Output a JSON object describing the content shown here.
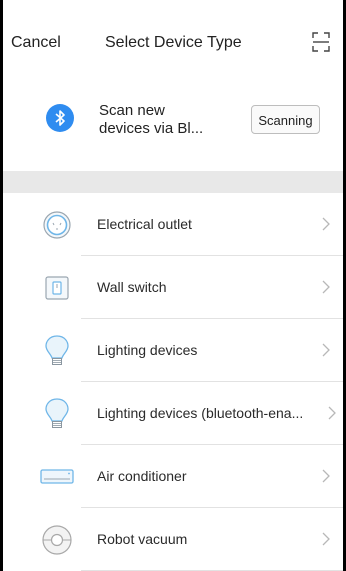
{
  "header": {
    "cancel_label": "Cancel",
    "title": "Select Device Type",
    "scan_icon": "scan-frame-icon"
  },
  "scan": {
    "icon": "bluetooth-icon",
    "text_line1": "Scan new",
    "text_line2": "devices via Bl...",
    "button_label": "Scanning"
  },
  "devices": [
    {
      "label": "Electrical outlet",
      "icon": "outlet-icon"
    },
    {
      "label": "Wall switch",
      "icon": "wall-switch-icon"
    },
    {
      "label": "Lighting devices",
      "icon": "bulb-icon"
    },
    {
      "label": "Lighting devices (bluetooth-ena...",
      "icon": "bulb-icon"
    },
    {
      "label": "Air conditioner",
      "icon": "air-conditioner-icon"
    },
    {
      "label": "Robot vacuum",
      "icon": "robot-vacuum-icon"
    }
  ],
  "colors": {
    "bluetooth": "#2f8cf0",
    "icon_accent": "#6fb6e8",
    "band": "#e8e8e8"
  }
}
